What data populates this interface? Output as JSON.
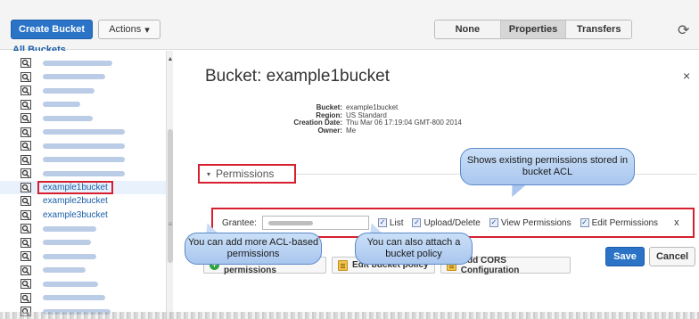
{
  "toolbar": {
    "create_bucket": "Create Bucket",
    "actions": "Actions",
    "actions_caret": "▾",
    "all_buckets": "All Buckets",
    "views": [
      "None",
      "Properties",
      "Transfers"
    ],
    "active_view": "Properties",
    "refresh_icon": "⟳"
  },
  "sidebar": {
    "icon": "bucket-search-icon",
    "named_buckets": [
      "example1bucket",
      "example2bucket",
      "example3bucket"
    ],
    "selected": "example1bucket",
    "scroll_up": "▲",
    "scroll_grip": "≡"
  },
  "panel": {
    "title": "Bucket: example1bucket",
    "close": "×",
    "meta": [
      {
        "label": "Bucket:",
        "value": "example1bucket"
      },
      {
        "label": "Region:",
        "value": "US Standard"
      },
      {
        "label": "Creation Date:",
        "value": "Thu Mar 06 17:19:04 GMT-800 2014"
      },
      {
        "label": "Owner:",
        "value": "Me"
      }
    ],
    "permissions_caret": "▾",
    "permissions_label": "Permissions",
    "grantee_label": "Grantee:",
    "checkboxes": [
      {
        "label": "List",
        "checked": true
      },
      {
        "label": "Upload/Delete",
        "checked": true
      },
      {
        "label": "View Permissions",
        "checked": true
      },
      {
        "label": "Edit Permissions",
        "checked": true
      }
    ],
    "check_mark": "✓",
    "remove": "x",
    "add_more_permissions": "Add more permissions",
    "plus_glyph": "+",
    "edit_bucket_policy": "Edit bucket policy",
    "add_cors": "Add CORS Configuration",
    "save": "Save",
    "cancel": "Cancel"
  },
  "callouts": {
    "acl": "Shows existing permissions stored in bucket ACL",
    "add_acl": "You can add more ACL-based permissions",
    "attach_policy": "You can also attach a bucket policy"
  },
  "colors": {
    "primary": "#2a73c6",
    "highlight": "#d6202f",
    "callout": "#b9d2f2"
  }
}
